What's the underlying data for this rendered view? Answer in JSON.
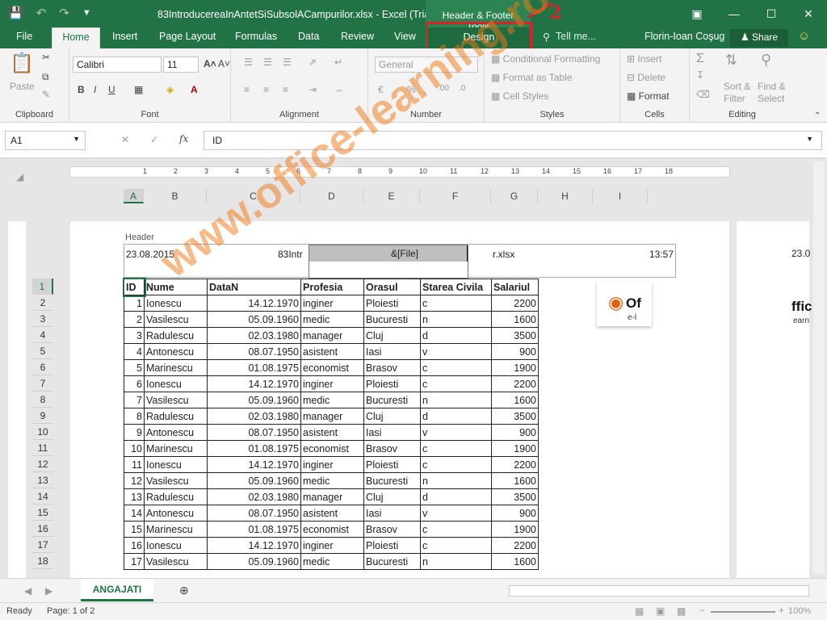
{
  "window": {
    "title": "83IntroducereaInAntetSiSubsolACampurilor.xlsx - Excel (Trial)",
    "contextual_title": "Header & Footer Tools",
    "annotation_number": "2",
    "user": "Florin-Ioan Coşug"
  },
  "tabs": [
    "File",
    "Home",
    "Insert",
    "Page Layout",
    "Formulas",
    "Data",
    "Review",
    "View",
    "Design"
  ],
  "tell_me": "Tell me...",
  "share": "Share",
  "ribbon": {
    "clipboard": {
      "paste": "Paste",
      "label": "Clipboard"
    },
    "font": {
      "name": "Calibri",
      "size": "11",
      "label": "Font"
    },
    "alignment": {
      "label": "Alignment"
    },
    "number": {
      "format": "General",
      "label": "Number"
    },
    "styles": {
      "conditional": "Conditional Formatting",
      "format_table": "Format as Table",
      "cell_styles": "Cell Styles",
      "label": "Styles"
    },
    "cells": {
      "insert": "Insert",
      "delete": "Delete",
      "format": "Format",
      "label": "Cells"
    },
    "editing": {
      "sort": "Sort &",
      "filter": "Filter",
      "find": "Find &",
      "select": "Select",
      "label": "Editing"
    }
  },
  "formula": {
    "namebox": "A1",
    "content": "ID"
  },
  "ruler_numbers": [
    "1",
    "2",
    "3",
    "4",
    "5",
    "6",
    "7",
    "8",
    "9",
    "10",
    "11",
    "12",
    "13",
    "14",
    "15",
    "16",
    "17",
    "18"
  ],
  "columns": [
    "A",
    "B",
    "C",
    "D",
    "E",
    "F",
    "G",
    "H",
    "I"
  ],
  "header": {
    "label": "Header",
    "left": "23.08.2015",
    "center_pre": "83Intr",
    "center_edit": "&[File]",
    "center_post": "r.xlsx",
    "right": "13:57",
    "page2_left": "23.0"
  },
  "rows": [
    "1",
    "2",
    "3",
    "4",
    "5",
    "6",
    "7",
    "8",
    "9",
    "10",
    "11",
    "12",
    "13",
    "14",
    "15",
    "16",
    "17",
    "18"
  ],
  "table": {
    "headers": [
      "ID",
      "Nume",
      "DataN",
      "Profesia",
      "Orasul",
      "Starea Civila",
      "Salariul"
    ],
    "data": [
      [
        "1",
        "Ionescu",
        "14.12.1970",
        "inginer",
        "Ploiesti",
        "c",
        "2200"
      ],
      [
        "2",
        "Vasilescu",
        "05.09.1960",
        "medic",
        "Bucuresti",
        "n",
        "1600"
      ],
      [
        "3",
        "Radulescu",
        "02.03.1980",
        "manager",
        "Cluj",
        "d",
        "3500"
      ],
      [
        "4",
        "Antonescu",
        "08.07.1950",
        "asistent",
        "Iasi",
        "v",
        "900"
      ],
      [
        "5",
        "Marinescu",
        "01.08.1975",
        "economist",
        "Brasov",
        "c",
        "1900"
      ],
      [
        "6",
        "Ionescu",
        "14.12.1970",
        "inginer",
        "Ploiesti",
        "c",
        "2200"
      ],
      [
        "7",
        "Vasilescu",
        "05.09.1960",
        "medic",
        "Bucuresti",
        "n",
        "1600"
      ],
      [
        "8",
        "Radulescu",
        "02.03.1980",
        "manager",
        "Cluj",
        "d",
        "3500"
      ],
      [
        "9",
        "Antonescu",
        "08.07.1950",
        "asistent",
        "Iasi",
        "v",
        "900"
      ],
      [
        "10",
        "Marinescu",
        "01.08.1975",
        "economist",
        "Brasov",
        "c",
        "1900"
      ],
      [
        "11",
        "Ionescu",
        "14.12.1970",
        "inginer",
        "Ploiesti",
        "c",
        "2200"
      ],
      [
        "12",
        "Vasilescu",
        "05.09.1960",
        "medic",
        "Bucuresti",
        "n",
        "1600"
      ],
      [
        "13",
        "Radulescu",
        "02.03.1980",
        "manager",
        "Cluj",
        "d",
        "3500"
      ],
      [
        "14",
        "Antonescu",
        "08.07.1950",
        "asistent",
        "Iasi",
        "v",
        "900"
      ],
      [
        "15",
        "Marinescu",
        "01.08.1975",
        "economist",
        "Brasov",
        "c",
        "1900"
      ],
      [
        "16",
        "Ionescu",
        "14.12.1970",
        "inginer",
        "Ploiesti",
        "c",
        "2200"
      ],
      [
        "17",
        "Vasilescu",
        "05.09.1960",
        "medic",
        "Bucuresti",
        "n",
        "1600"
      ]
    ]
  },
  "watermark": "www.office-learning.ro",
  "logo": {
    "text": "Of",
    "sub": "e-l",
    "text2": "ffic",
    "sub2": "earn"
  },
  "sheet_tab": "ANGAJATI",
  "status": {
    "ready": "Ready",
    "page": "Page: 1 of 2",
    "zoom": "100%"
  },
  "colors": {
    "excel_green": "#217346",
    "annotation_red": "#d8232a"
  }
}
